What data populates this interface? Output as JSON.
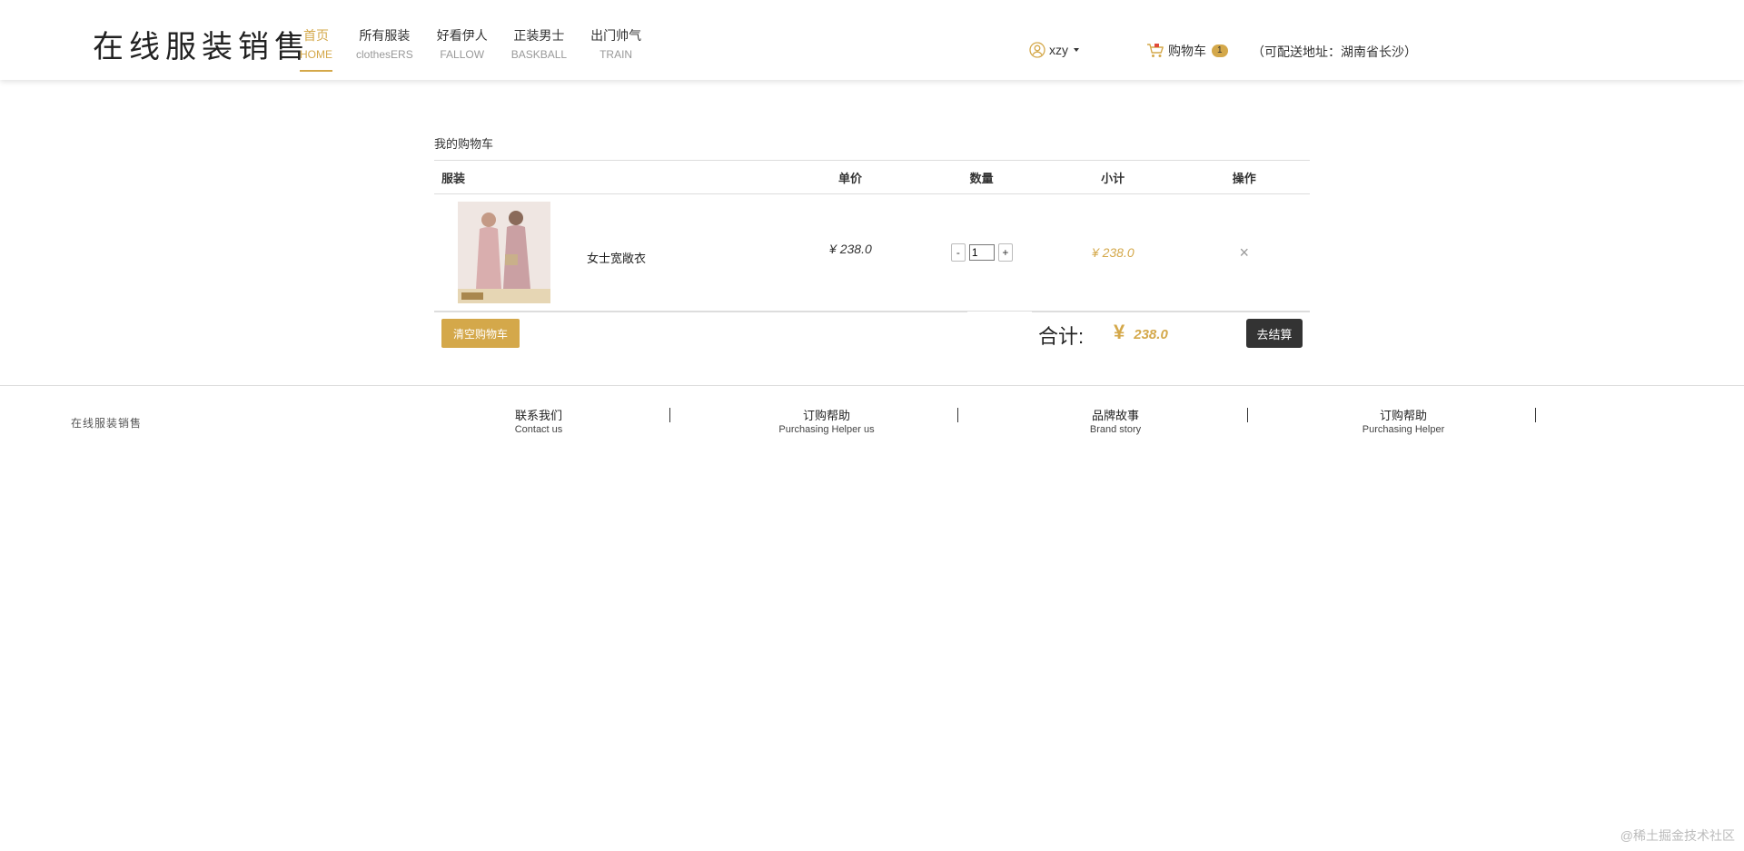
{
  "header": {
    "logo": "在线服装销售",
    "nav": [
      {
        "zh": "首页",
        "en": "HOME",
        "active": true
      },
      {
        "zh": "所有服装",
        "en": "clothesERS"
      },
      {
        "zh": "好看伊人",
        "en": "FALLOW"
      },
      {
        "zh": "正装男士",
        "en": "BASKBALL"
      },
      {
        "zh": "出门帅气",
        "en": "TRAIN"
      }
    ],
    "user": "xzy",
    "cart_label": "购物车",
    "cart_count": "1",
    "address": "（可配送地址：湖南省长沙）"
  },
  "cart": {
    "title": "我的购物车",
    "headers": {
      "product": "服装",
      "price": "单价",
      "qty": "数量",
      "subtotal": "小计",
      "op": "操作"
    },
    "items": [
      {
        "name": "女士宽敞衣",
        "price": "¥ 238.0",
        "qty": "1",
        "subtotal": "¥ 238.0"
      }
    ],
    "qty_minus": "-",
    "qty_plus": "+",
    "delete_symbol": "×",
    "clear_label": "清空购物车",
    "total_label": "合计:",
    "total_currency": "¥",
    "total_value": "238.0",
    "checkout_label": "去结算"
  },
  "footer": {
    "brand": "在线服装销售",
    "links": [
      {
        "zh": "联系我们",
        "en": "Contact us"
      },
      {
        "zh": "订购帮助",
        "en": "Purchasing Helper us"
      },
      {
        "zh": "品牌故事",
        "en": "Brand story"
      },
      {
        "zh": "订购帮助",
        "en": "Purchasing Helper"
      }
    ]
  },
  "watermark": "@稀土掘金技术社区",
  "colors": {
    "accent": "#d4a84a",
    "dark_button": "#333333"
  }
}
